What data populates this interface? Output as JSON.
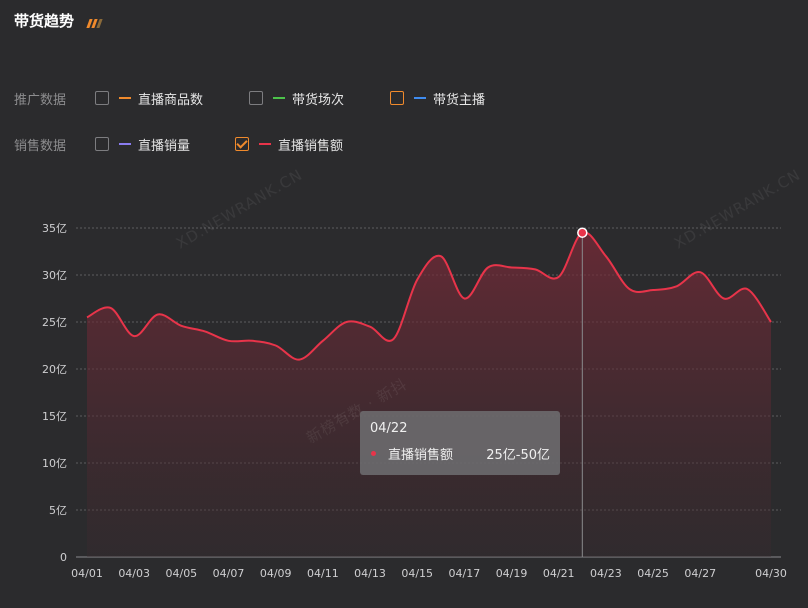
{
  "header": {
    "title": "带货趋势"
  },
  "filters": {
    "promo": {
      "label": "推广数据",
      "options": [
        {
          "label": "直播商品数",
          "checked": false,
          "color": "#f08a2c"
        },
        {
          "label": "带货场次",
          "checked": false,
          "color": "#4cc34a"
        },
        {
          "label": "带货主播",
          "checked": false,
          "color": "#3f8cf0"
        }
      ]
    },
    "sales": {
      "label": "销售数据",
      "options": [
        {
          "label": "直播销量",
          "checked": false,
          "color": "#8a7cf0"
        },
        {
          "label": "直播销售额",
          "checked": true,
          "color": "#e8344a"
        }
      ]
    }
  },
  "watermarks": [
    "XD.NEWRANK.CN",
    "XD.NEWRANK.CN",
    "新榜有数 · 新抖"
  ],
  "tooltip": {
    "date": "04/22",
    "series": "直播销售额",
    "value": "25亿-50亿",
    "color": "#e8344a"
  },
  "colors": {
    "accent": "#f08a2c",
    "line": "#e8344a"
  },
  "chart_data": {
    "type": "area",
    "series": [
      {
        "name": "直播销售额",
        "values": [
          25.5,
          26.5,
          23.5,
          25.8,
          24.6,
          24.0,
          23.0,
          23.0,
          22.5,
          21.0,
          23.0,
          25.0,
          24.5,
          23.2,
          29.5,
          32.0,
          27.5,
          30.8,
          30.8,
          30.6,
          29.8,
          34.5,
          32.0,
          28.5,
          28.4,
          28.8,
          30.3,
          27.5,
          28.5,
          25.0
        ]
      }
    ],
    "x": [
      "04/01",
      "04/02",
      "04/03",
      "04/04",
      "04/05",
      "04/06",
      "04/07",
      "04/08",
      "04/09",
      "04/10",
      "04/11",
      "04/12",
      "04/13",
      "04/14",
      "04/15",
      "04/16",
      "04/17",
      "04/18",
      "04/19",
      "04/20",
      "04/21",
      "04/22",
      "04/23",
      "04/24",
      "04/25",
      "04/26",
      "04/27",
      "04/28",
      "04/29",
      "04/30"
    ],
    "x_tick_labels": [
      "04/01",
      "04/03",
      "04/05",
      "04/07",
      "04/09",
      "04/11",
      "04/13",
      "04/15",
      "04/17",
      "04/19",
      "04/21",
      "04/23",
      "04/25",
      "04/27",
      "04/30"
    ],
    "y_tick_labels": [
      "0",
      "5亿",
      "10亿",
      "15亿",
      "20亿",
      "25亿",
      "30亿",
      "35亿"
    ],
    "y_unit": "亿",
    "ylim": [
      0,
      35
    ],
    "highlight_index": 21,
    "grid": true,
    "title": "",
    "xlabel": "",
    "ylabel": ""
  }
}
